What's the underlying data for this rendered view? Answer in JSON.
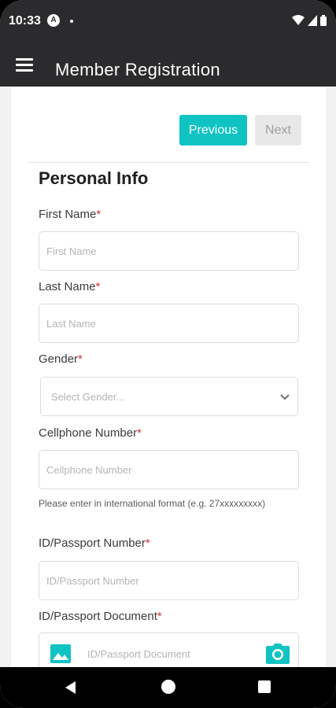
{
  "status_bar": {
    "time": "10:33",
    "notif_letter": "A"
  },
  "app_bar": {
    "title": "Member Registration",
    "menu_icon": "hamburger-menu-icon"
  },
  "nav_buttons": {
    "previous": "Previous",
    "next": "Next"
  },
  "section": {
    "title": "Personal Info"
  },
  "fields": {
    "first_name": {
      "label": "First Name",
      "required": "*",
      "placeholder": "First Name"
    },
    "last_name": {
      "label": "Last Name",
      "required": "*",
      "placeholder": "Last Name"
    },
    "gender": {
      "label": "Gender",
      "required": "*",
      "placeholder": "Select Gender..."
    },
    "cellphone": {
      "label": "Cellphone Number",
      "required": "*",
      "placeholder": "Cellphone Number",
      "help": "Please enter in international format (e.g. 27xxxxxxxxx)"
    },
    "id_number": {
      "label": "ID/Passport Number",
      "required": "*",
      "placeholder": "ID/Passport Number"
    },
    "id_document": {
      "label": "ID/Passport Document",
      "required": "*",
      "placeholder": "ID/Passport Document"
    }
  },
  "colors": {
    "accent": "#10c3c3",
    "app_bar": "#2b2b2d",
    "required": "#d32f2f"
  }
}
